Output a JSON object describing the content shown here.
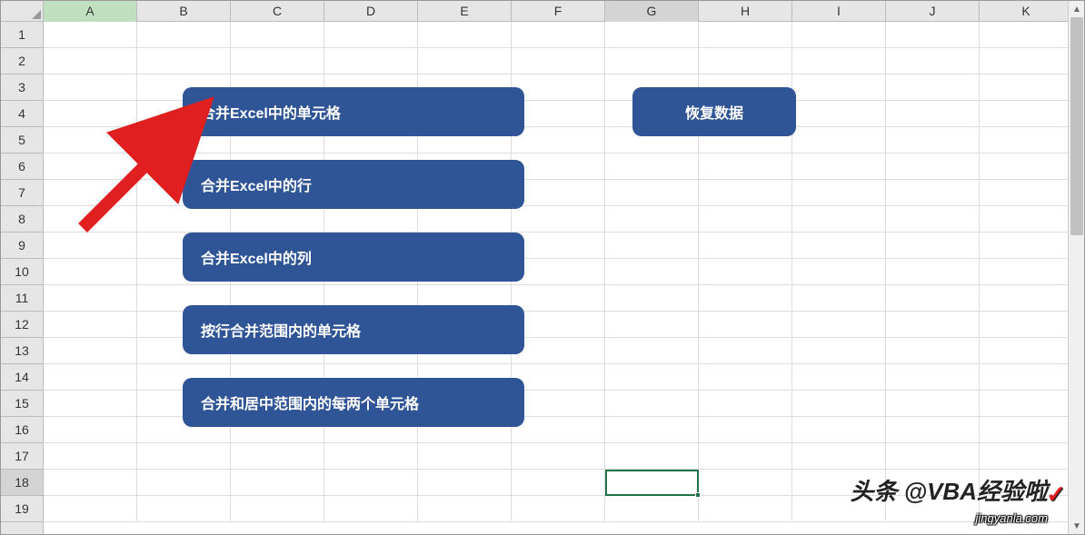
{
  "columns": [
    "A",
    "B",
    "C",
    "D",
    "E",
    "F",
    "G",
    "H",
    "I",
    "J",
    "K"
  ],
  "rows": [
    "1",
    "2",
    "3",
    "4",
    "5",
    "6",
    "7",
    "8",
    "9",
    "10",
    "11",
    "12",
    "13",
    "14",
    "15",
    "16",
    "17",
    "18",
    "19"
  ],
  "selected_column_index": 0,
  "active_column_index": 6,
  "active_row_index": 17,
  "active_cell": "G18",
  "buttons": {
    "merge_cells": "合并Excel中的单元格",
    "merge_rows": "合并Excel中的行",
    "merge_cols": "合并Excel中的列",
    "merge_by_row": "按行合并范围内的单元格",
    "merge_center_pairs": "合并和居中范围内的每两个单元格",
    "restore_data": "恢复数据"
  },
  "watermarks": {
    "author": "头条 @VBA经验啦",
    "site": "jingyanla.com",
    "check": "✓"
  }
}
